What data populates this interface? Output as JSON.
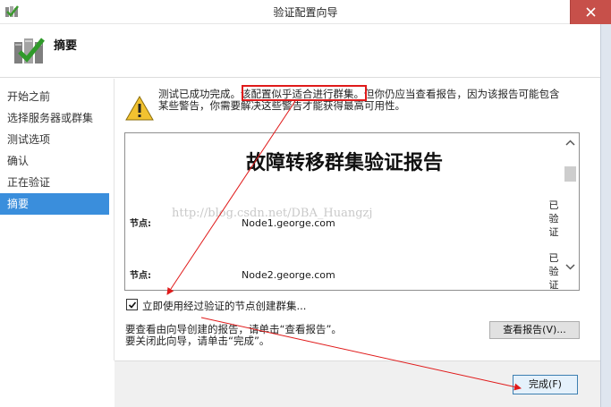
{
  "window": {
    "title": "验证配置向导"
  },
  "header": {
    "title": "摘要"
  },
  "nav": {
    "items": [
      {
        "label": "开始之前"
      },
      {
        "label": "选择服务器或群集"
      },
      {
        "label": "测试选项"
      },
      {
        "label": "确认"
      },
      {
        "label": "正在验证"
      },
      {
        "label": "摘要"
      }
    ],
    "active_index": 5
  },
  "summary": {
    "line1": "测试已成功完成。该配置似乎适合进行群集。但你仍应当查看报告，因为该报告可能包含",
    "line2": "某些警告，你需要解决这些警告才能获得最高可用性。"
  },
  "report": {
    "title": "故障转移群集验证报告",
    "watermark": "http://blog.csdn.net/DBA_Huangzj",
    "nodes": [
      {
        "label": "节点:",
        "value": "Node1.george.com",
        "status": [
          "已",
          "验",
          "证"
        ]
      },
      {
        "label": "节点:",
        "value": "Node2.george.com",
        "status": [
          "已",
          "验",
          "证"
        ]
      }
    ]
  },
  "create_cluster": {
    "label": "立即使用经过验证的节点创建群集...",
    "checked": true
  },
  "hints": {
    "view": "要查看由向导创建的报告，请单击“查看报告”。",
    "close": "要关闭此向导，请单击“完成”。"
  },
  "buttons": {
    "view_report": "查看报告(V)...",
    "finish": "完成(F)"
  },
  "colors": {
    "accent": "#3a8edc",
    "annotation": "#e01a1a",
    "close": "#c7504a"
  }
}
